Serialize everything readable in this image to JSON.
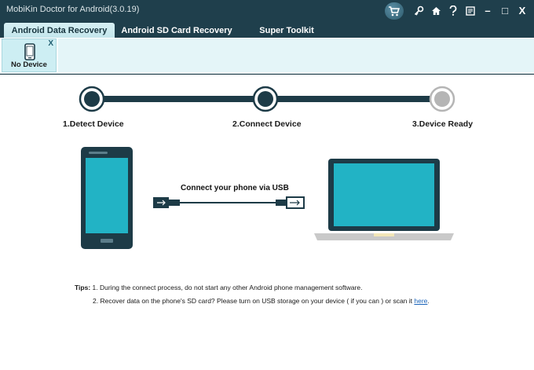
{
  "window": {
    "title": "MobiKin Doctor for Android(3.0.19)",
    "controls": {
      "cart": "cart-icon",
      "key": "key-icon",
      "home": "home-icon",
      "help": "help-icon",
      "feedback": "feedback-icon",
      "minimize": "–",
      "maximize": "□",
      "close": "X"
    }
  },
  "tabs": [
    {
      "label": "Android Data Recovery",
      "active": true
    },
    {
      "label": "Android SD Card Recovery",
      "active": false
    },
    {
      "label": "Super Toolkit",
      "active": false
    }
  ],
  "device_bar": {
    "device_label": "No Device",
    "close_label": "X"
  },
  "steps": [
    {
      "label": "1.Detect Device",
      "state": "done"
    },
    {
      "label": "2.Connect Device",
      "state": "done"
    },
    {
      "label": "3.Device Ready",
      "state": "pending"
    }
  ],
  "connection": {
    "instruction": "Connect your phone via USB"
  },
  "tips": {
    "prefix": "Tips:",
    "line1": "1. During the connect process, do not start any other Android phone management software.",
    "line2_text": "2. Recover data on the phone's SD card? Please turn on USB storage on your device ( if you can ) or scan it ",
    "line2_link": "here",
    "line2_end": "."
  },
  "colors": {
    "titlebar": "#1f3f4c",
    "accent_teal": "#22b3c5",
    "dark_slate": "#1d3b47",
    "pending_gray": "#b5b5b5"
  }
}
